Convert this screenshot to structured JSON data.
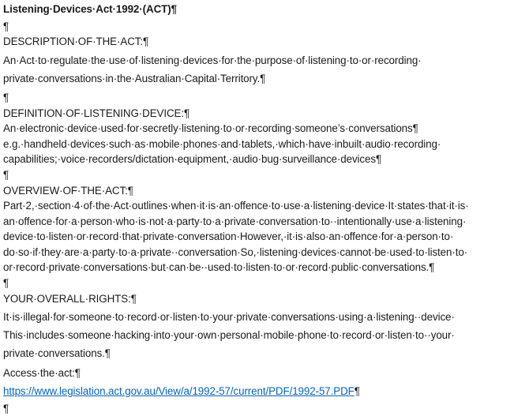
{
  "document": {
    "title": "Listening·Devices·Act·1992·(ACT)¶",
    "blank": "¶",
    "description": {
      "heading": "DESCRIPTION·OF·THE·ACT:¶",
      "lines": [
        "An·Act·to·regulate·the·use·of·listening·devices·for·the·purpose·of·listening·to·or·recording·",
        "private·conversations·in·the·Australian·Capital·Territory.¶"
      ]
    },
    "definition": {
      "heading": "DEFINITION·OF·LISTENING·DEVICE:¶",
      "lines": [
        "An·electronic·device·used·for·secretly·listening·to·or·recording·someone’s·conversations¶",
        "e.g.·handheld·devices·such·as·mobile·phones·and·tablets,·which·have·inbuilt·audio·recording·",
        "capabilities;·voice·recorders/dictation·equipment,·audio·bug·surveillance·devices¶"
      ]
    },
    "overview": {
      "heading": "OVERVIEW·OF·THE·ACT:¶",
      "lines": [
        "Part·2,·section·4·of·the·Act·outlines·when·it·is·an·offence·to·use·a·listening·device·It·states·that·it·is·",
        "an·offence·for·a·person·who·is·not·a·party·to·a·private·conversation·to··intentionally·use·a·listening·",
        "device·to·listen·or·record·that·private·conversation·However,·it·is·also·an·offence·for·a·person·to·",
        "do·so·if·they·are·a·party·to·a·private··conversation·So,·listening·devices·cannot·be·used·to·listen·to·",
        "or·record·private·conversations·but·can·be··used·to·listen·to·or·record·public·conversations.¶"
      ]
    },
    "rights": {
      "heading": "YOUR·OVERALL·RIGHTS:¶",
      "lines": [
        "It·is·illegal·for·someone·to·record·or·listen·to·your·private·conversations·using·a·listening··device·",
        "This·includes·someone·hacking·into·your·own·personal·mobile·phone·to·record·or·listen·to··your·",
        "private·conversations.¶"
      ]
    },
    "access": {
      "label": "Access·the·act:¶",
      "link": "https://www.legislation.act.gov.au/View/a/1992-57/current/PDF/1992-57.PDF",
      "link_mark": "¶"
    },
    "link_color": "#0563c1"
  }
}
